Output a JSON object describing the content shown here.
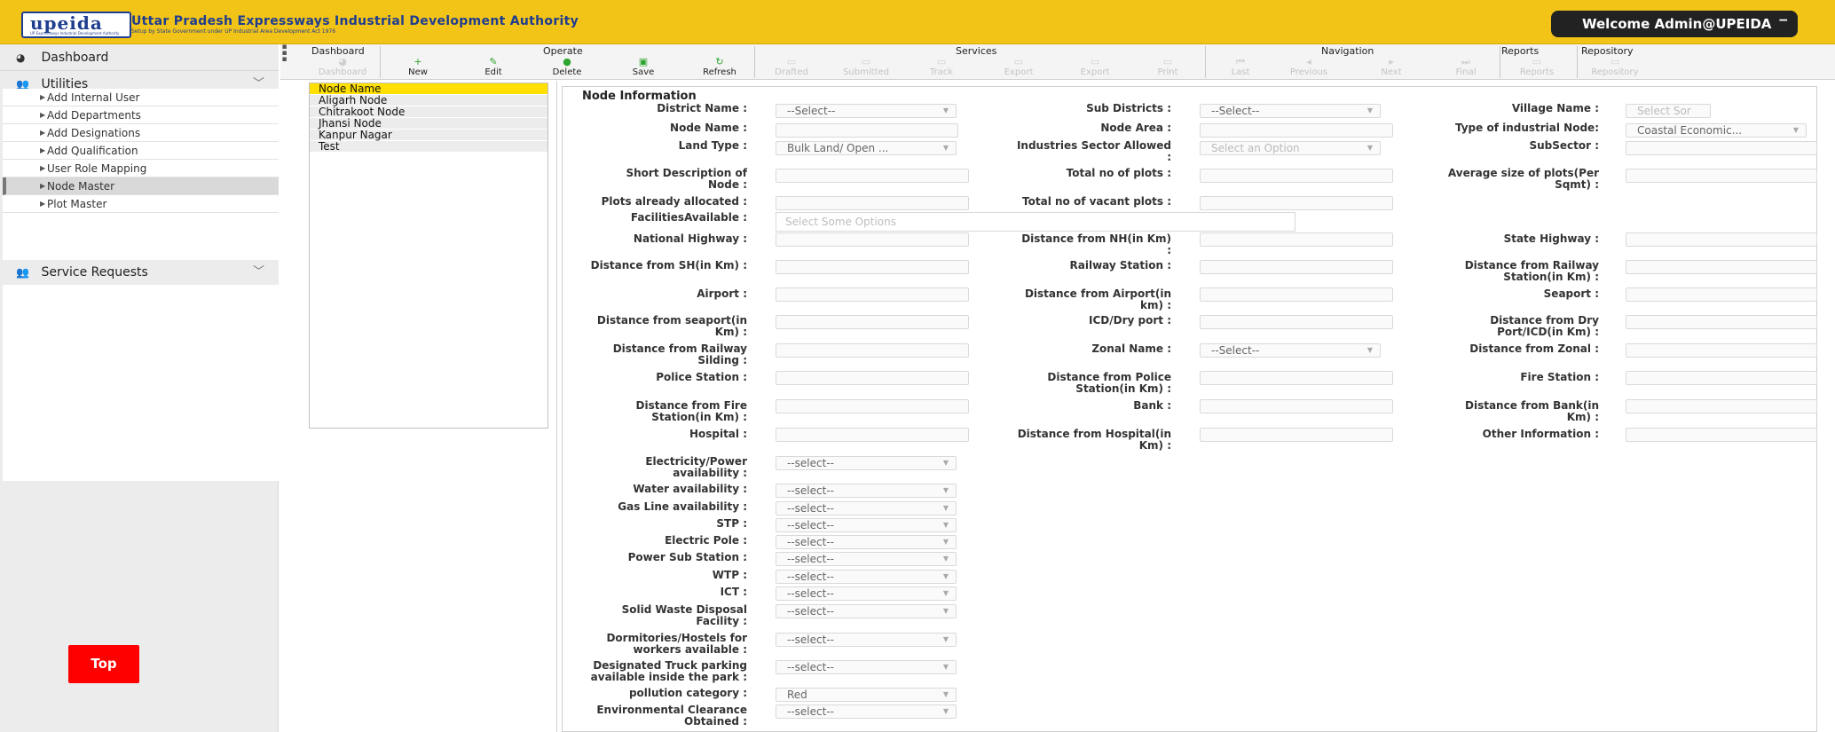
{
  "header": {
    "logo_text": "upeida",
    "logo_small": "UP Expressways Industrial Development Authority",
    "title": "Uttar Pradesh Expressways Industrial Development Authority",
    "subtitle": "Setup by State Government under UP Industrial Area Development Act 1976",
    "welcome": "Welcome Admin@UPEIDA",
    "brand_color": "#f3c418"
  },
  "sidebar": {
    "dashboard": "Dashboard",
    "utilities": "Utilities",
    "items": [
      "Add Internal User",
      "Add Departments",
      "Add Designations",
      "Add Qualification",
      "User Role Mapping",
      "Node Master",
      "Plot Master"
    ],
    "active_item": "Node Master",
    "service_requests": "Service Requests",
    "top_button": "Top"
  },
  "toolbar": {
    "groups": [
      "Dashboard",
      "Operate",
      "Services",
      "Navigation",
      "Reports",
      "Repository"
    ],
    "buttons": {
      "dashboard": "Dashboard",
      "new": "New",
      "edit": "Edit",
      "delete": "Delete",
      "save": "Save",
      "refresh": "Refresh",
      "drafted": "Drafted",
      "submitted": "Submitted",
      "track": "Track",
      "export1": "Export",
      "export2": "Export",
      "print": "Print",
      "last": "Last",
      "previous": "Previous",
      "next": "Next",
      "final": "Final",
      "reports": "Reports",
      "repository": "Repository"
    }
  },
  "node_list": {
    "header": "Node Name",
    "items": [
      "Aligarh Node",
      "Chitrakoot Node",
      "Jhansi Node",
      "Kanpur Nagar",
      "Test"
    ]
  },
  "form": {
    "title": "Node Information",
    "district_name": "District Name :",
    "sub_districts": "Sub Districts :",
    "village_name": "Village Name :",
    "node_name": "Node Name :",
    "node_area": "Node Area :",
    "type_industrial_node": "Type of industrial Node:",
    "land_type": "Land Type :",
    "industries_sector_1": "Industries Sector Allowed",
    "industries_sector_2": ":",
    "subsector": "SubSector :",
    "short_desc_1": "Short Description of",
    "short_desc_2": "Node :",
    "total_plots": "Total no of plots :",
    "avg_size_1": "Average size of plots(Per",
    "avg_size_2": "Sqmt) :",
    "plots_allocated": "Plots already allocated :",
    "vacant_plots": "Total no of vacant plots :",
    "facilities": "FacilitiesAvailable :",
    "national_highway": "National Highway :",
    "dist_nh_1": "Distance from NH(in Km)",
    "dist_nh_2": ":",
    "state_highway": "State Highway :",
    "dist_sh": "Distance from SH(in Km) :",
    "railway_station": "Railway Station :",
    "dist_railway_1": "Distance from Railway",
    "dist_railway_2": "Station(in Km) :",
    "airport": "Airport :",
    "dist_airport_1": "Distance from Airport(in",
    "dist_airport_2": "km) :",
    "seaport": "Seaport :",
    "dist_seaport_1": "Distance from seaport(in",
    "dist_seaport_2": "Km) :",
    "icd_port": "ICD/Dry port :",
    "dist_dry_1": "Distance from Dry",
    "dist_dry_2": "Port/ICD(in Km) :",
    "dist_siding_1": "Distance from Railway",
    "dist_siding_2": "Silding :",
    "zonal_name": "Zonal Name :",
    "dist_zonal": "Distance from Zonal :",
    "police_station": "Police Station :",
    "dist_police_1": "Distance from Police",
    "dist_police_2": "Station(in Km) :",
    "fire_station": "Fire Station :",
    "dist_fire_1": "Distance from Fire",
    "dist_fire_2": "Station(in Km) :",
    "bank": "Bank :",
    "dist_bank_1": "Distance from Bank(in",
    "dist_bank_2": "Km) :",
    "hospital": "Hospital :",
    "dist_hospital_1": "Distance from Hospital(in",
    "dist_hospital_2": "Km) :",
    "other_info": "Other Information :",
    "electricity_1": "Electricity/Power",
    "electricity_2": "availability :",
    "water": "Water availability :",
    "gas_line": "Gas Line availability :",
    "stp": "STP :",
    "electric_pole": "Electric Pole :",
    "power_sub": "Power Sub Station :",
    "wtp": "WTP :",
    "ict": "ICT :",
    "solid_waste_1": "Solid Waste Disposal",
    "solid_waste_2": "Facility :",
    "dormitories_1": "Dormitories/Hostels for",
    "dormitories_2": "workers available :",
    "truck_parking_1": "Designated Truck parking",
    "truck_parking_2": "available inside the park :",
    "pollution": "pollution category :",
    "env_clearance_1": "Environmental Clearance",
    "env_clearance_2": "Obtained :",
    "values": {
      "select_cap": "--Select--",
      "select_low": "--select--",
      "land_type": "Bulk Land/ Open ...",
      "sector_placeholder": "Select an Option",
      "village_placeholder": "Select Sor",
      "industrial_node": "Coastal Economic...",
      "facilities_placeholder": "Select Some Options",
      "pollution": "Red"
    }
  }
}
